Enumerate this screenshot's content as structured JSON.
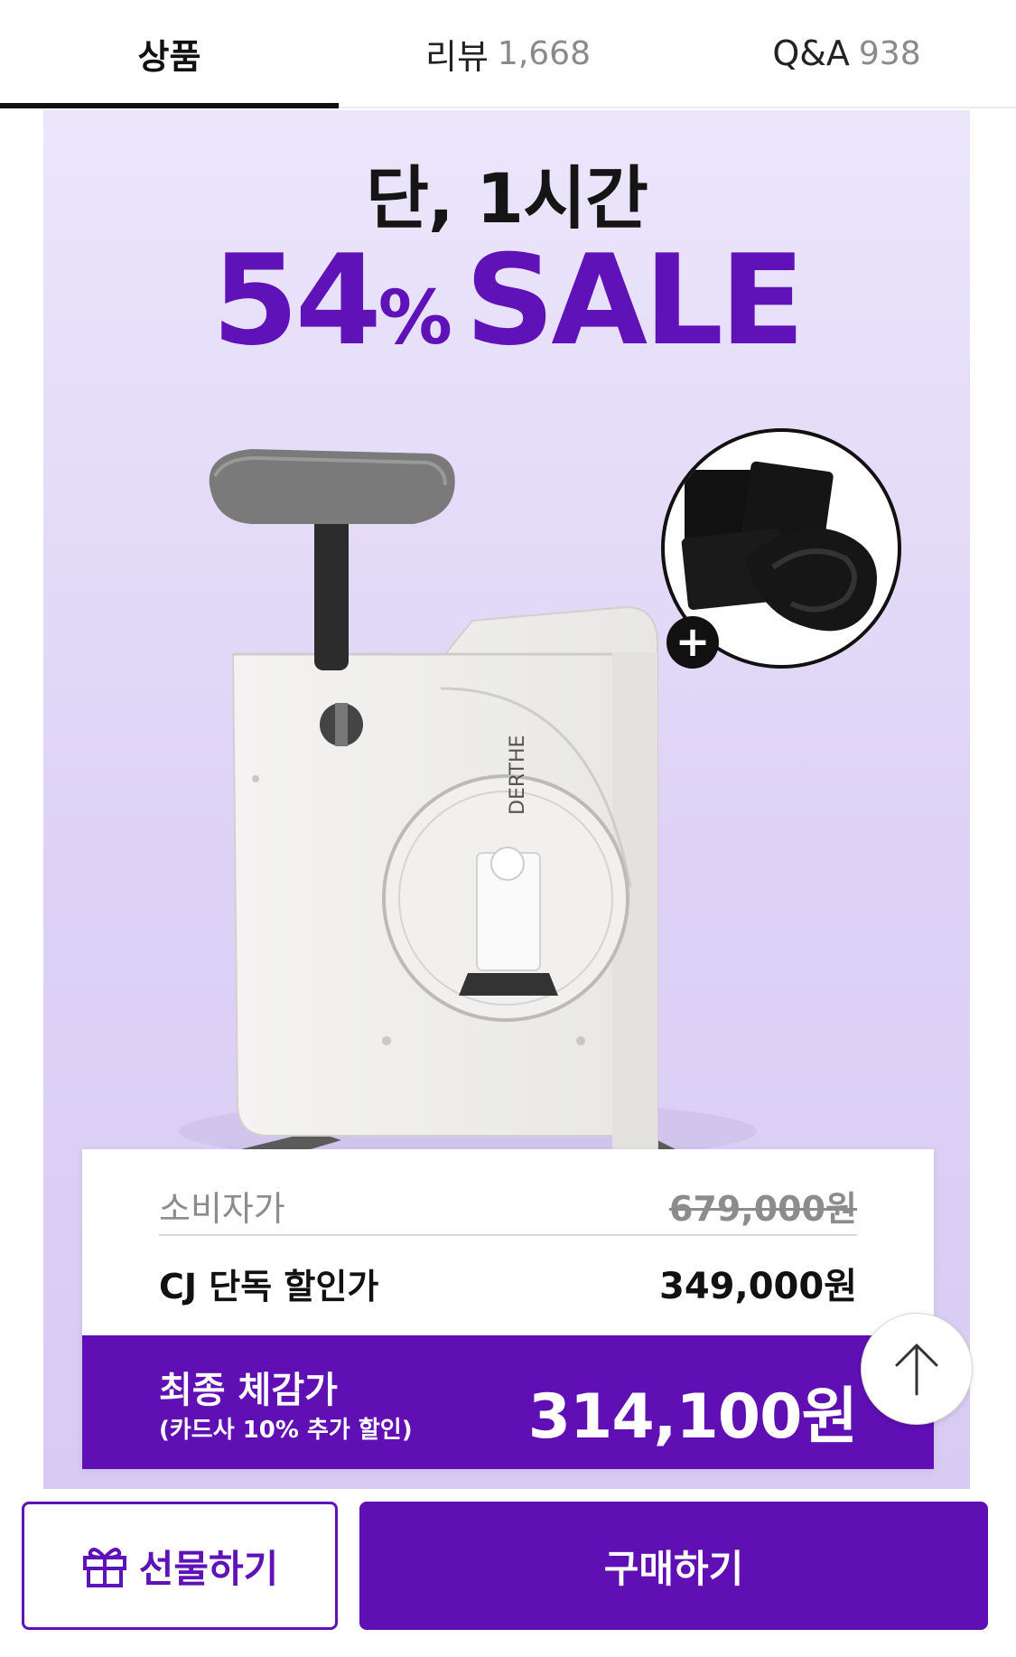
{
  "tabs": [
    {
      "label": "상품",
      "count": ""
    },
    {
      "label": "리뷰",
      "count": "1,668"
    },
    {
      "label": "Q&A",
      "count": "938"
    }
  ],
  "banner": {
    "headline": "단, 1시간",
    "sale_number": "54",
    "sale_percent": "%",
    "sale_word": "SALE",
    "brand_mark": "DERTHE",
    "plus_icon": "+"
  },
  "price": {
    "consumer_label": "소비자가",
    "consumer_value": "679,000원",
    "cj_label": "CJ 단독 할인가",
    "cj_value": "349,000원",
    "final_label": "최종 체감가",
    "final_sub": "(카드사 10% 추가 할인)",
    "final_value": "314,100원"
  },
  "actions": {
    "gift_label": "선물하기",
    "buy_label": "구매하기"
  },
  "colors": {
    "accent": "#5f0fb3",
    "banner_bg": "#e6ddf8"
  },
  "icons": {
    "gift": "gift-icon",
    "scroll_top": "arrow-up-icon"
  }
}
